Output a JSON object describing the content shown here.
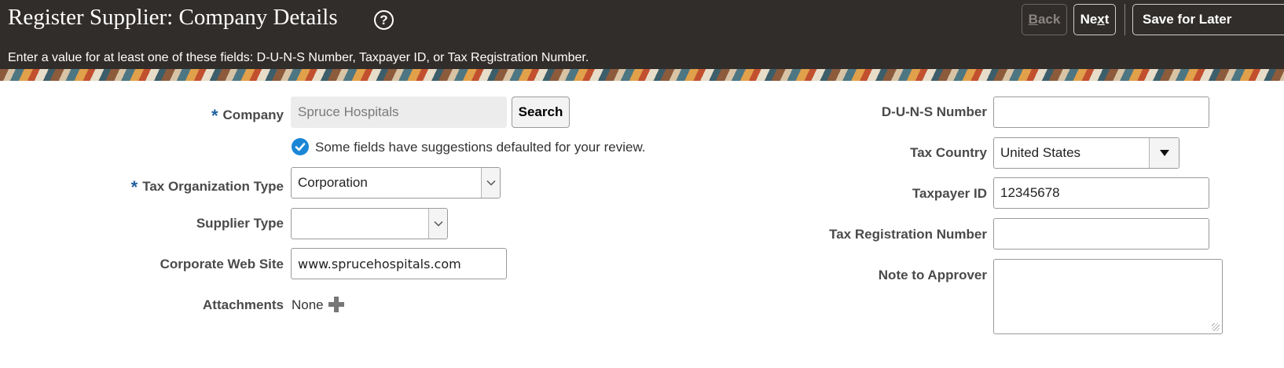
{
  "header": {
    "title": "Register Supplier: Company Details",
    "help_icon": "?",
    "subtitle": "Enter a value for at least one of these fields: D-U-N-S Number, Taxpayer ID, or Tax Registration Number.",
    "back": {
      "pre": "",
      "key": "B",
      "post": "ack"
    },
    "next": {
      "pre": "Ne",
      "key": "x",
      "post": "t"
    },
    "save_label": "Save for Later"
  },
  "left_form": {
    "required_mark": "*",
    "company": {
      "label": "Company",
      "value": "Spruce Hospitals",
      "search_label": "Search"
    },
    "suggestion_message": "Some fields have suggestions defaulted for your review.",
    "tax_org_type": {
      "label": "Tax Organization Type",
      "value": "Corporation"
    },
    "supplier_type": {
      "label": "Supplier Type",
      "value": ""
    },
    "corporate_web_site": {
      "label": "Corporate Web Site",
      "value": "www.sprucehospitals.com"
    },
    "attachments": {
      "label": "Attachments",
      "value": "None"
    }
  },
  "right_form": {
    "duns": {
      "label": "D-U-N-S Number",
      "value": ""
    },
    "tax_country": {
      "label": "Tax Country",
      "value": "United States"
    },
    "taxpayer_id": {
      "label": "Taxpayer ID",
      "value": "12345678"
    },
    "tax_registration_number": {
      "label": "Tax Registration Number",
      "value": ""
    },
    "note_to_approver": {
      "label": "Note to Approver",
      "value": ""
    }
  },
  "icons": {
    "help": "help-circle-icon",
    "check": "check-circle-icon",
    "chevron": "chevron-down-icon",
    "caret": "caret-down-icon",
    "add": "plus-icon",
    "grip": "resize-grip-icon"
  },
  "colors": {
    "header_bg": "#312d2a",
    "required": "#1f5f9e",
    "info_icon": "#1a86d6"
  }
}
